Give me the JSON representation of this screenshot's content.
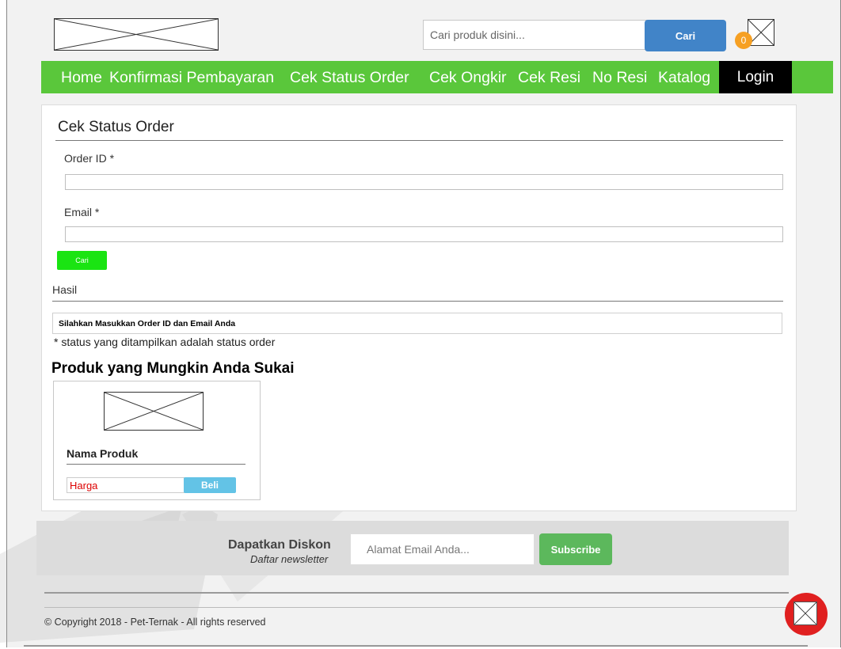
{
  "header": {
    "search": {
      "placeholder": "Cari produk disini...",
      "button_label": "Cari"
    },
    "cart": {
      "count": "0",
      "icon": "image-placeholder-icon"
    },
    "logo_icon": "image-placeholder-icon"
  },
  "nav": {
    "items": [
      "Home",
      "Konfirmasi Pembayaran",
      "Cek Status Order",
      "Cek Ongkir",
      "Cek Resi",
      "No Resi",
      "Katalog"
    ],
    "login_label": "Login",
    "color": "#5ac73b"
  },
  "form": {
    "title": "Cek Status Order",
    "order_id_label": "Order ID  *",
    "email_label": "Email *",
    "submit_label": "Cari"
  },
  "result": {
    "heading": "Hasil",
    "message": "Silahkan Masukkan Order ID dan Email Anda",
    "note": "* status yang ditampilkan adalah status order"
  },
  "recommendations": {
    "title": "Produk yang Mungkin Anda Sukai",
    "products": [
      {
        "name": "Nama Produk",
        "price": "Harga",
        "buy_label": "Beli"
      }
    ]
  },
  "newsletter": {
    "title": "Dapatkan Diskon",
    "subtitle": "Daftar newsletter",
    "email_placeholder": "Alamat Email Anda...",
    "subscribe_label": "Subscribe"
  },
  "footer": {
    "copyright": "© Copyright 2018 - Pet-Ternak - All rights reserved"
  },
  "colors": {
    "accent": "#5ac73b",
    "search_button": "#4184c8",
    "cart_badge": "#f6a023",
    "submit_button": "#1ae412",
    "buy_button": "#63c3e6",
    "subscribe_button": "#5cb85c",
    "price": "#dd0000",
    "help_badge": "#e02020"
  }
}
